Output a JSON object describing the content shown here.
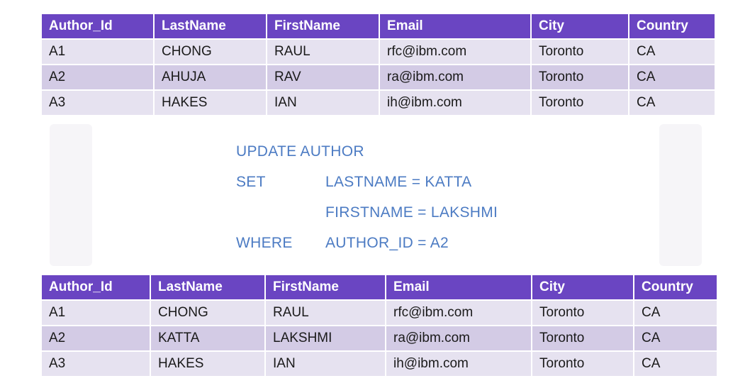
{
  "before_table": {
    "headers": [
      "Author_Id",
      "LastName",
      "FirstName",
      "Email",
      "City",
      "Country"
    ],
    "rows": [
      [
        "A1",
        "CHONG",
        "RAUL",
        "rfc@ibm.com",
        "Toronto",
        "CA"
      ],
      [
        "A2",
        "AHUJA",
        "RAV",
        "ra@ibm.com",
        "Toronto",
        "CA"
      ],
      [
        "A3",
        "HAKES",
        "IAN",
        "ih@ibm.com",
        "Toronto",
        "CA"
      ]
    ]
  },
  "sql": {
    "line1_keyword": "UPDATE AUTHOR",
    "line2_keyword": "SET",
    "line2_expr": "LASTNAME = KATTA",
    "line3_expr": "FIRSTNAME = LAKSHMI",
    "line4_keyword": "WHERE",
    "line4_expr": "AUTHOR_ID = A2"
  },
  "after_table": {
    "headers": [
      "Author_Id",
      "LastName",
      "FirstName",
      "Email",
      "City",
      "Country"
    ],
    "rows": [
      [
        "A1",
        "CHONG",
        "RAUL",
        "rfc@ibm.com",
        "Toronto",
        "CA"
      ],
      [
        "A2",
        "KATTA",
        "LAKSHMI",
        "ra@ibm.com",
        "Toronto",
        "CA"
      ],
      [
        "A3",
        "HAKES",
        "IAN",
        "ih@ibm.com",
        "Toronto",
        "CA"
      ]
    ]
  },
  "colors": {
    "header_bg": "#6a45c2",
    "row_light": "#e6e2f0",
    "row_dark": "#d3cbe5",
    "sql_text": "#4c7bc3"
  }
}
